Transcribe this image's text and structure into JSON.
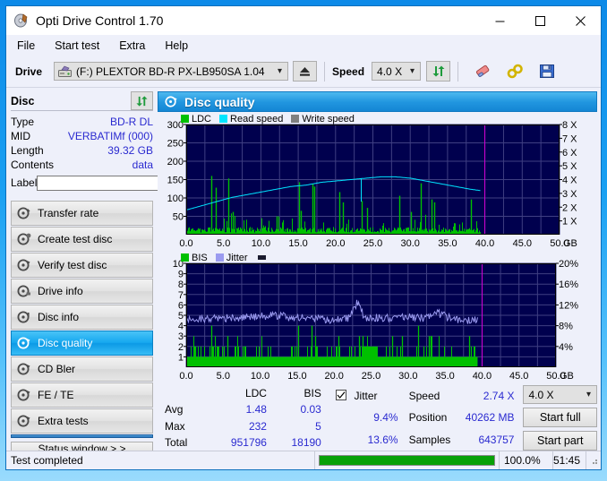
{
  "window": {
    "title": "Opti Drive Control 1.70",
    "app_icon": "disc-icon",
    "minimize": "—",
    "maximize": "□",
    "close": "✕"
  },
  "menu": {
    "items": [
      "File",
      "Start test",
      "Extra",
      "Help"
    ]
  },
  "toolbar": {
    "drive_label": "Drive",
    "drive_value": "(F:)  PLEXTOR BD-R  PX-LB950SA 1.04",
    "eject_icon": "eject-icon",
    "speed_label": "Speed",
    "speed_value": "4.0 X",
    "refresh_icon": "refresh-icon",
    "eraser_icon": "eraser-icon",
    "tools_icon": "tools-icon",
    "save_icon": "save-icon"
  },
  "disc_panel": {
    "title": "Disc",
    "refresh_icon": "refresh-icon",
    "rows": [
      {
        "key": "Type",
        "value": "BD-R DL"
      },
      {
        "key": "MID",
        "value": "VERBATIMf (000)"
      },
      {
        "key": "Length",
        "value": "39.32 GB"
      },
      {
        "key": "Contents",
        "value": "data"
      }
    ],
    "label_key": "Label",
    "label_value": "",
    "label_placeholder": "",
    "disc_icon": "cd-icon"
  },
  "nav": {
    "items": [
      {
        "label": "Transfer rate",
        "icon": "disc-speed-icon",
        "selected": false
      },
      {
        "label": "Create test disc",
        "icon": "disc-write-icon",
        "selected": false
      },
      {
        "label": "Verify test disc",
        "icon": "disc-check-icon",
        "selected": false
      },
      {
        "label": "Drive info",
        "icon": "drive-info-icon",
        "selected": false
      },
      {
        "label": "Disc info",
        "icon": "disc-info-icon",
        "selected": false
      },
      {
        "label": "Disc quality",
        "icon": "disc-quality-icon",
        "selected": true
      },
      {
        "label": "CD Bler",
        "icon": "disc-bler-icon",
        "selected": false
      },
      {
        "label": "FE / TE",
        "icon": "disc-fete-icon",
        "selected": false
      },
      {
        "label": "Extra tests",
        "icon": "disc-extra-icon",
        "selected": false
      }
    ],
    "status_window_button": "Status window > >"
  },
  "quality_panel": {
    "title": "Disc quality",
    "icon": "disc-quality-icon"
  },
  "stats": {
    "col_ldc": "LDC",
    "col_bis": "BIS",
    "rows": [
      {
        "label": "Avg",
        "ldc": "1.48",
        "bis": "0.03"
      },
      {
        "label": "Max",
        "ldc": "232",
        "bis": "5"
      },
      {
        "label": "Total",
        "ldc": "951796",
        "bis": "18190"
      }
    ],
    "jitter_checked": true,
    "jitter_label": "Jitter",
    "jitter_avg": "9.4%",
    "jitter_max": "13.6%",
    "speed_label": "Speed",
    "speed_value": "2.74 X",
    "position_label": "Position",
    "position_value": "40262 MB",
    "samples_label": "Samples",
    "samples_value": "643757",
    "speed_select": "4.0 X",
    "start_full": "Start full",
    "start_part": "Start part"
  },
  "statusbar": {
    "message": "Test completed",
    "percent": "100.0%",
    "progress": 100,
    "elapsed": "51:45"
  },
  "colors": {
    "ldc_green": "#00c000",
    "read_speed_cyan": "#00e5ff",
    "write_speed_gray": "#808080",
    "bis_green": "#00c000",
    "jitter_purple": "#9b9bf0",
    "plot_bg": "#00004e",
    "grid": "#3a3a7a",
    "marker_magenta": "#d000d0",
    "accent_blue": "#1486d4",
    "value_blue": "#2a2ad0",
    "progress_green": "#07a007"
  },
  "chart_data": [
    {
      "type": "line",
      "name": "ldc-read-speed-chart",
      "title": "",
      "xlabel": "GB",
      "ylabel": "",
      "xlim": [
        0,
        50
      ],
      "xticks": [
        "0.0",
        "5.0",
        "10.0",
        "15.0",
        "20.0",
        "25.0",
        "30.0",
        "35.0",
        "40.0",
        "45.0",
        "50.0"
      ],
      "ylim": [
        0,
        300
      ],
      "yticks": [
        50,
        100,
        150,
        200,
        250,
        300
      ],
      "y2label": "X",
      "y2lim": [
        0,
        8
      ],
      "y2ticks": [
        "1 X",
        "2 X",
        "3 X",
        "4 X",
        "5 X",
        "6 X",
        "7 X",
        "8 X"
      ],
      "grid": true,
      "legend": [
        "LDC",
        "Read speed",
        "Write speed"
      ],
      "data_end_gb": 39.4,
      "marker_gb": 39.9,
      "series": [
        {
          "name": "Read speed",
          "color": "#00e5ff",
          "axis": "y2",
          "x": [
            0.0,
            2.0,
            4.0,
            6.0,
            8.0,
            10.0,
            12.0,
            14.0,
            16.0,
            18.0,
            20.0,
            22.0,
            24.0,
            26.0,
            28.0,
            30.0,
            32.0,
            34.0,
            36.0,
            38.0,
            39.4
          ],
          "values": [
            1.8,
            2.1,
            2.4,
            2.7,
            2.9,
            3.1,
            3.3,
            3.5,
            3.6,
            3.8,
            3.9,
            4.0,
            4.1,
            4.2,
            4.2,
            4.1,
            3.9,
            3.7,
            3.5,
            3.3,
            3.2
          ]
        },
        {
          "name": "LDC",
          "color": "#00c000",
          "axis": "y1",
          "baseline": 12,
          "peaks": [
            {
              "x": 3.3,
              "y": 160
            },
            {
              "x": 3.9,
              "y": 128
            },
            {
              "x": 5.6,
              "y": 153
            },
            {
              "x": 6.2,
              "y": 62
            },
            {
              "x": 12.1,
              "y": 50
            },
            {
              "x": 15.1,
              "y": 143
            },
            {
              "x": 15.3,
              "y": 65
            },
            {
              "x": 16.9,
              "y": 138
            },
            {
              "x": 17.1,
              "y": 131
            },
            {
              "x": 20.5,
              "y": 116
            },
            {
              "x": 21.0,
              "y": 88
            },
            {
              "x": 23.5,
              "y": 92
            },
            {
              "x": 24.2,
              "y": 73
            },
            {
              "x": 28.5,
              "y": 106
            },
            {
              "x": 30.1,
              "y": 62
            },
            {
              "x": 31.4,
              "y": 140
            },
            {
              "x": 32.8,
              "y": 96
            },
            {
              "x": 33.2,
              "y": 88
            },
            {
              "x": 38.1,
              "y": 96
            }
          ]
        }
      ]
    },
    {
      "type": "line",
      "name": "bis-jitter-chart",
      "title": "",
      "xlabel": "GB",
      "xlim": [
        0,
        50
      ],
      "xticks": [
        "0.0",
        "5.0",
        "10.0",
        "15.0",
        "20.0",
        "25.0",
        "30.0",
        "35.0",
        "40.0",
        "45.0",
        "50.0"
      ],
      "ylim": [
        0,
        10
      ],
      "yticks": [
        1,
        2,
        3,
        4,
        5,
        6,
        7,
        8,
        9,
        10
      ],
      "y2label": "%",
      "y2lim": [
        0,
        20
      ],
      "y2ticks": [
        "4%",
        "8%",
        "12%",
        "16%",
        "20%"
      ],
      "grid": true,
      "legend": [
        "BIS",
        "Jitter"
      ],
      "data_end_gb": 39.4,
      "marker_gb": 39.9,
      "series": [
        {
          "name": "Jitter",
          "color": "#9b9bf0",
          "axis": "y2",
          "x": [
            0.0,
            2.0,
            4.0,
            6.0,
            8.0,
            10.0,
            12.0,
            14.0,
            16.0,
            18.0,
            20.0,
            22.0,
            23.2,
            24.0,
            26.0,
            28.0,
            30.0,
            32.0,
            34.0,
            36.0,
            38.0,
            39.4
          ],
          "values": [
            9.2,
            9.3,
            9.4,
            9.5,
            9.6,
            9.8,
            10.0,
            9.6,
            9.5,
            9.4,
            9.0,
            9.4,
            12.8,
            9.6,
            9.5,
            9.4,
            9.6,
            9.5,
            10.4,
            9.2,
            9.0,
            9.1
          ]
        },
        {
          "name": "BIS",
          "color": "#00c000",
          "axis": "y1",
          "baseline": 1,
          "peaks": [
            {
              "x": 1.2,
              "y": 2
            },
            {
              "x": 3.4,
              "y": 4
            },
            {
              "x": 5.6,
              "y": 3
            },
            {
              "x": 7.9,
              "y": 2
            },
            {
              "x": 15.1,
              "y": 4
            },
            {
              "x": 16.9,
              "y": 4
            },
            {
              "x": 17.4,
              "y": 3
            },
            {
              "x": 20.6,
              "y": 3
            },
            {
              "x": 23.4,
              "y": 3
            },
            {
              "x": 23.9,
              "y": 3
            },
            {
              "x": 27.9,
              "y": 3
            },
            {
              "x": 29.2,
              "y": 3
            },
            {
              "x": 31.4,
              "y": 4
            },
            {
              "x": 32.8,
              "y": 3
            },
            {
              "x": 33.1,
              "y": 3
            },
            {
              "x": 38.2,
              "y": 3
            }
          ]
        }
      ]
    }
  ]
}
